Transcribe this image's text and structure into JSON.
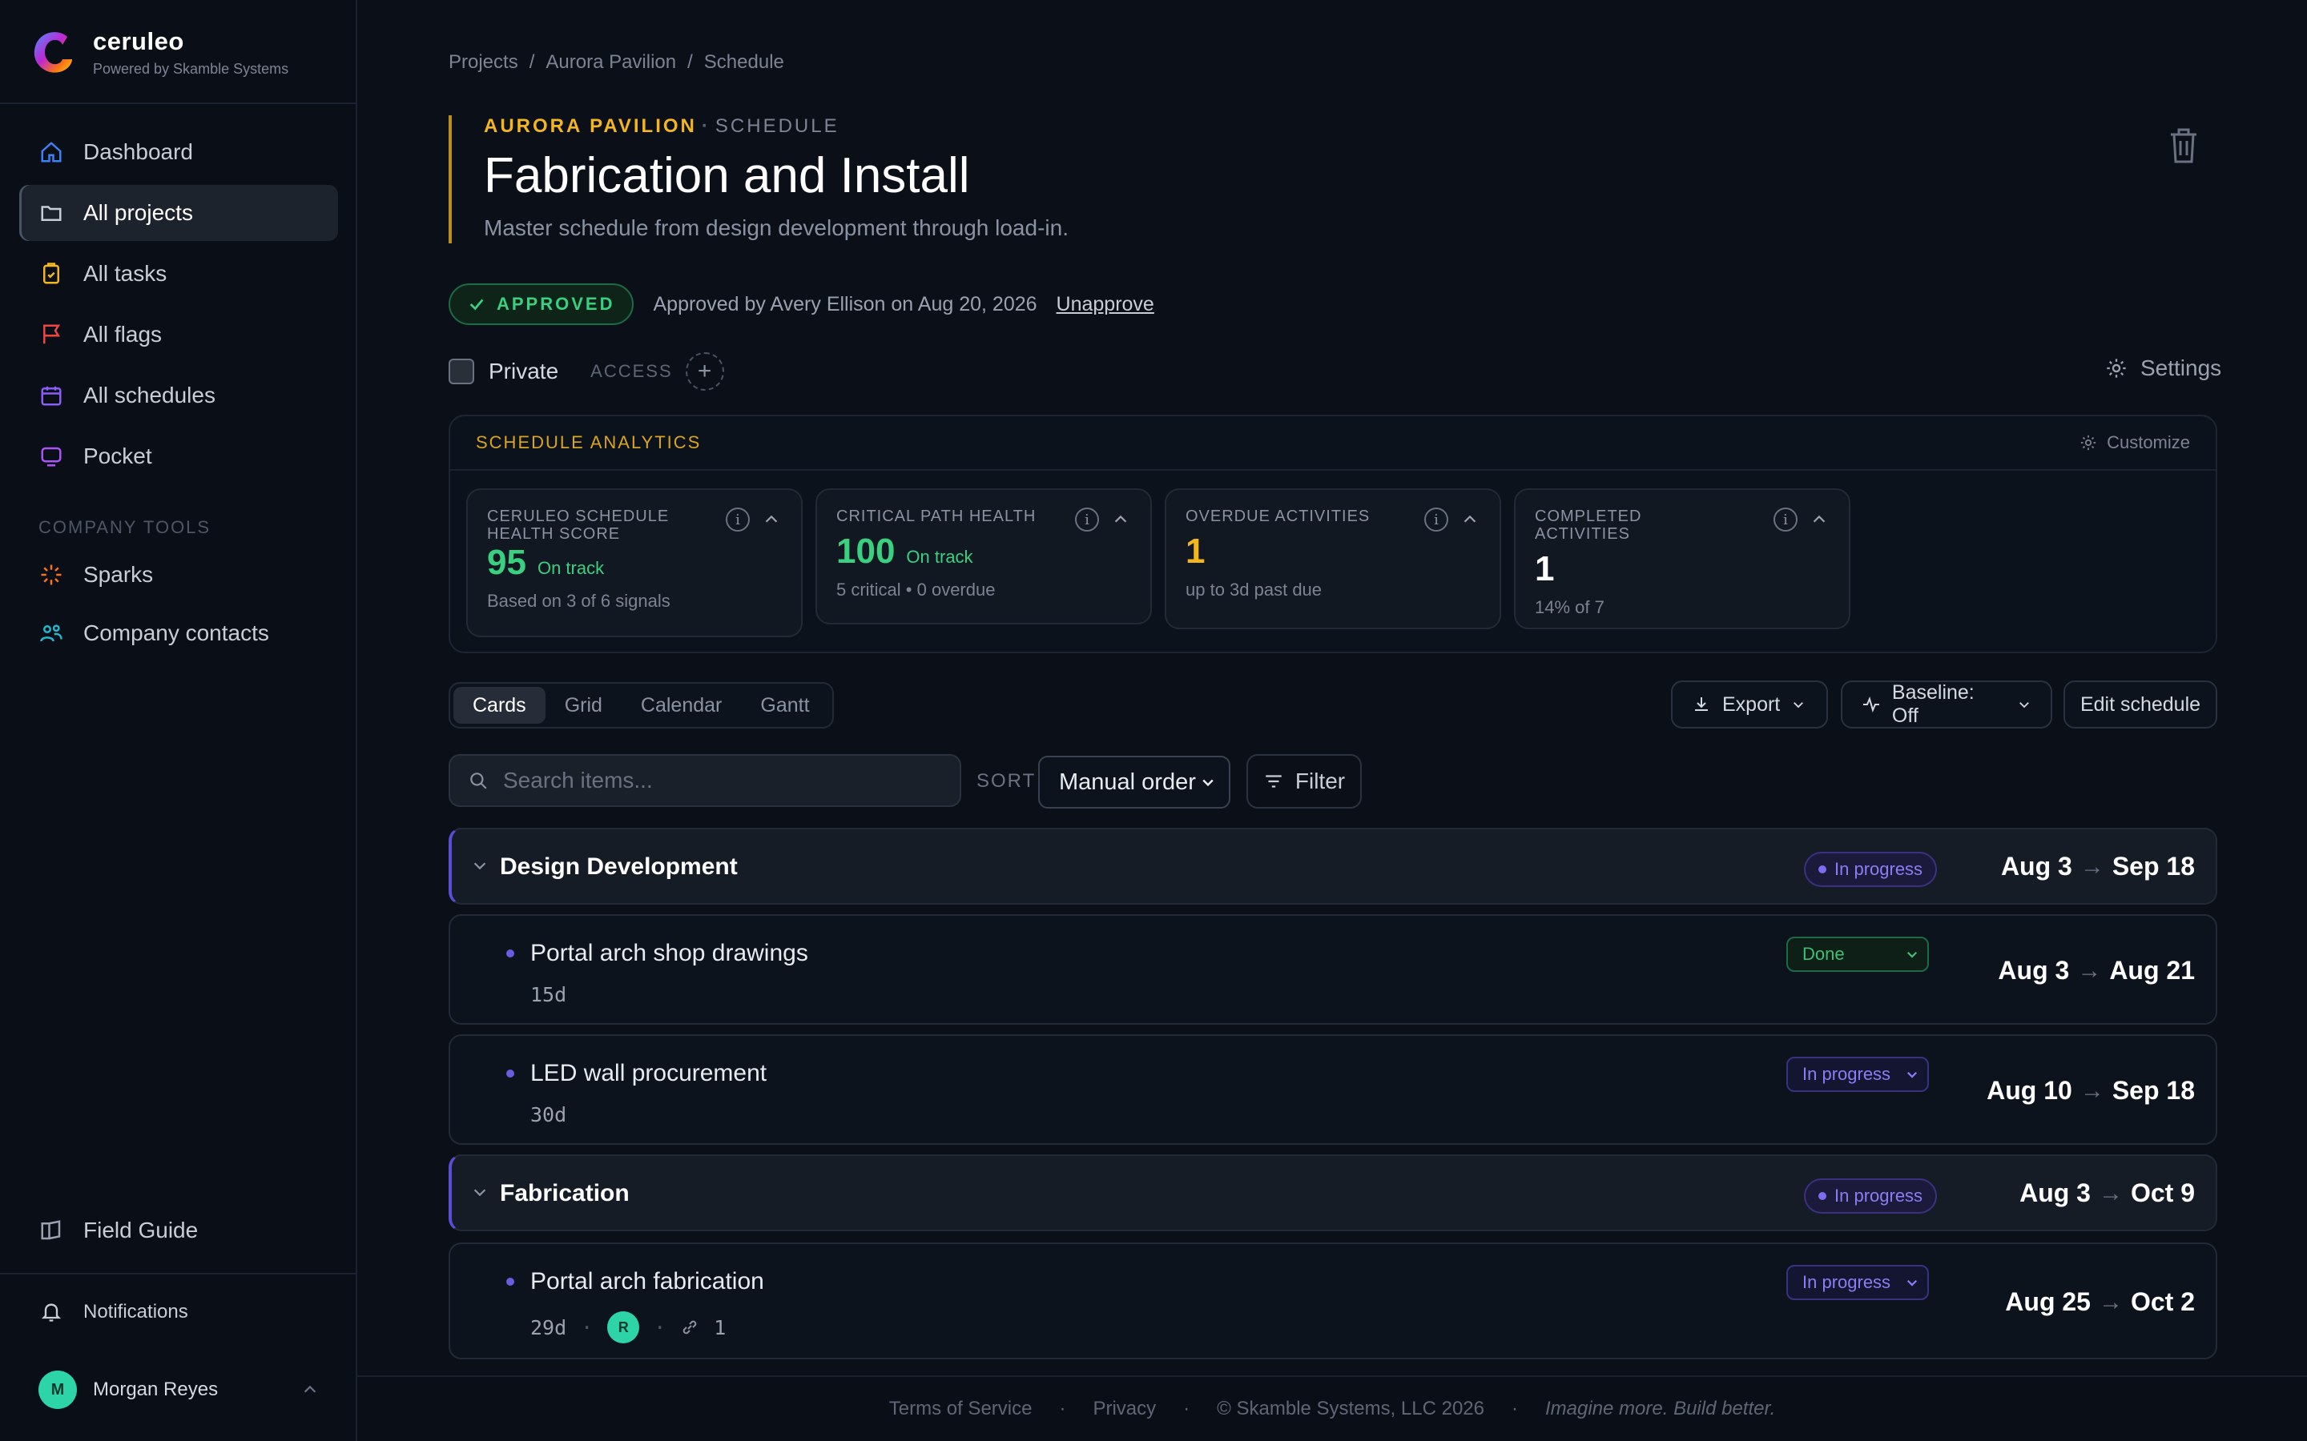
{
  "brand": {
    "name": "ceruleo",
    "subtitle": "Powered by Skamble Systems"
  },
  "sidebar": {
    "items": [
      {
        "label": "Dashboard",
        "icon": "home-icon",
        "color": "#3b82f6"
      },
      {
        "label": "All projects",
        "icon": "folder-icon",
        "color": "#c8cdd6",
        "active": true
      },
      {
        "label": "All tasks",
        "icon": "clipboard-icon",
        "color": "#f3b61f"
      },
      {
        "label": "All flags",
        "icon": "flag-icon",
        "color": "#ef4444"
      },
      {
        "label": "All schedules",
        "icon": "calendar-icon",
        "color": "#8b5cf6"
      },
      {
        "label": "Pocket",
        "icon": "pocket-icon",
        "color": "#a855f7"
      }
    ],
    "section_label": "COMPANY TOOLS",
    "tools": [
      {
        "label": "Sparks",
        "icon": "spark-icon",
        "color": "#f97316"
      },
      {
        "label": "Company contacts",
        "icon": "contacts-icon",
        "color": "#22b8cf"
      }
    ],
    "field_guide": "Field Guide",
    "notifications": "Notifications",
    "user": {
      "initial": "M",
      "name": "Morgan Reyes"
    }
  },
  "breadcrumb": [
    "Projects",
    "Aurora Pavilion",
    "Schedule"
  ],
  "breadcrumb_sep": "/",
  "header": {
    "project": "AURORA PAVILION",
    "section": "SCHEDULE",
    "title": "Fabrication and Install",
    "subtitle": "Master schedule from design development through load-in."
  },
  "approval": {
    "badge": "APPROVED",
    "text": "Approved by Avery Ellison on Aug 20, 2026",
    "action": "Unapprove"
  },
  "privacy": {
    "label": "Private",
    "access_label": "ACCESS",
    "settings": "Settings"
  },
  "analytics": {
    "title": "SCHEDULE ANALYTICS",
    "customize": "Customize",
    "metrics": [
      {
        "label": "CERULEO SCHEDULE HEALTH SCORE",
        "value": "95",
        "status": "On track",
        "foot": "Based on 3 of 6 signals",
        "color": "#39d07f"
      },
      {
        "label": "CRITICAL PATH HEALTH",
        "value": "100",
        "status": "On track",
        "foot": "5 critical • 0 overdue",
        "color": "#39d07f"
      },
      {
        "label": "OVERDUE ACTIVITIES",
        "value": "1",
        "status": "",
        "foot": "up to 3d past due",
        "color": "#f3b61f"
      },
      {
        "label": "COMPLETED ACTIVITIES",
        "value": "1",
        "status": "",
        "foot": "14% of 7",
        "color": "#ffffff"
      }
    ]
  },
  "views": {
    "tabs": [
      "Cards",
      "Grid",
      "Calendar",
      "Gantt"
    ],
    "active": "Cards"
  },
  "toolbar": {
    "export": "Export",
    "baseline": "Baseline: Off",
    "edit": "Edit schedule"
  },
  "search": {
    "placeholder": "Search items..."
  },
  "sort": {
    "label": "SORT",
    "value": "Manual order"
  },
  "filter": "Filter",
  "rows": [
    {
      "kind": "group",
      "title": "Design Development",
      "status": "In progress",
      "start": "Aug 3",
      "end": "Sep 18"
    },
    {
      "kind": "item",
      "title": "Portal arch shop drawings",
      "duration": "15d",
      "status": "Done",
      "start": "Aug 3",
      "end": "Aug 21"
    },
    {
      "kind": "item",
      "title": "LED wall procurement",
      "duration": "30d",
      "status": "In progress",
      "start": "Aug 10",
      "end": "Sep 18"
    },
    {
      "kind": "group",
      "title": "Fabrication",
      "status": "In progress",
      "start": "Aug 3",
      "end": "Oct 9"
    },
    {
      "kind": "item",
      "title": "Portal arch fabrication",
      "duration": "29d",
      "assignee": "R",
      "links": "1",
      "status": "In progress",
      "start": "Aug 25",
      "end": "Oct 2"
    }
  ],
  "footer": {
    "terms": "Terms of Service",
    "privacy": "Privacy",
    "copyright": "© Skamble Systems, LLC 2026",
    "tagline": "Imagine more. Build better.",
    "sep": "·"
  }
}
